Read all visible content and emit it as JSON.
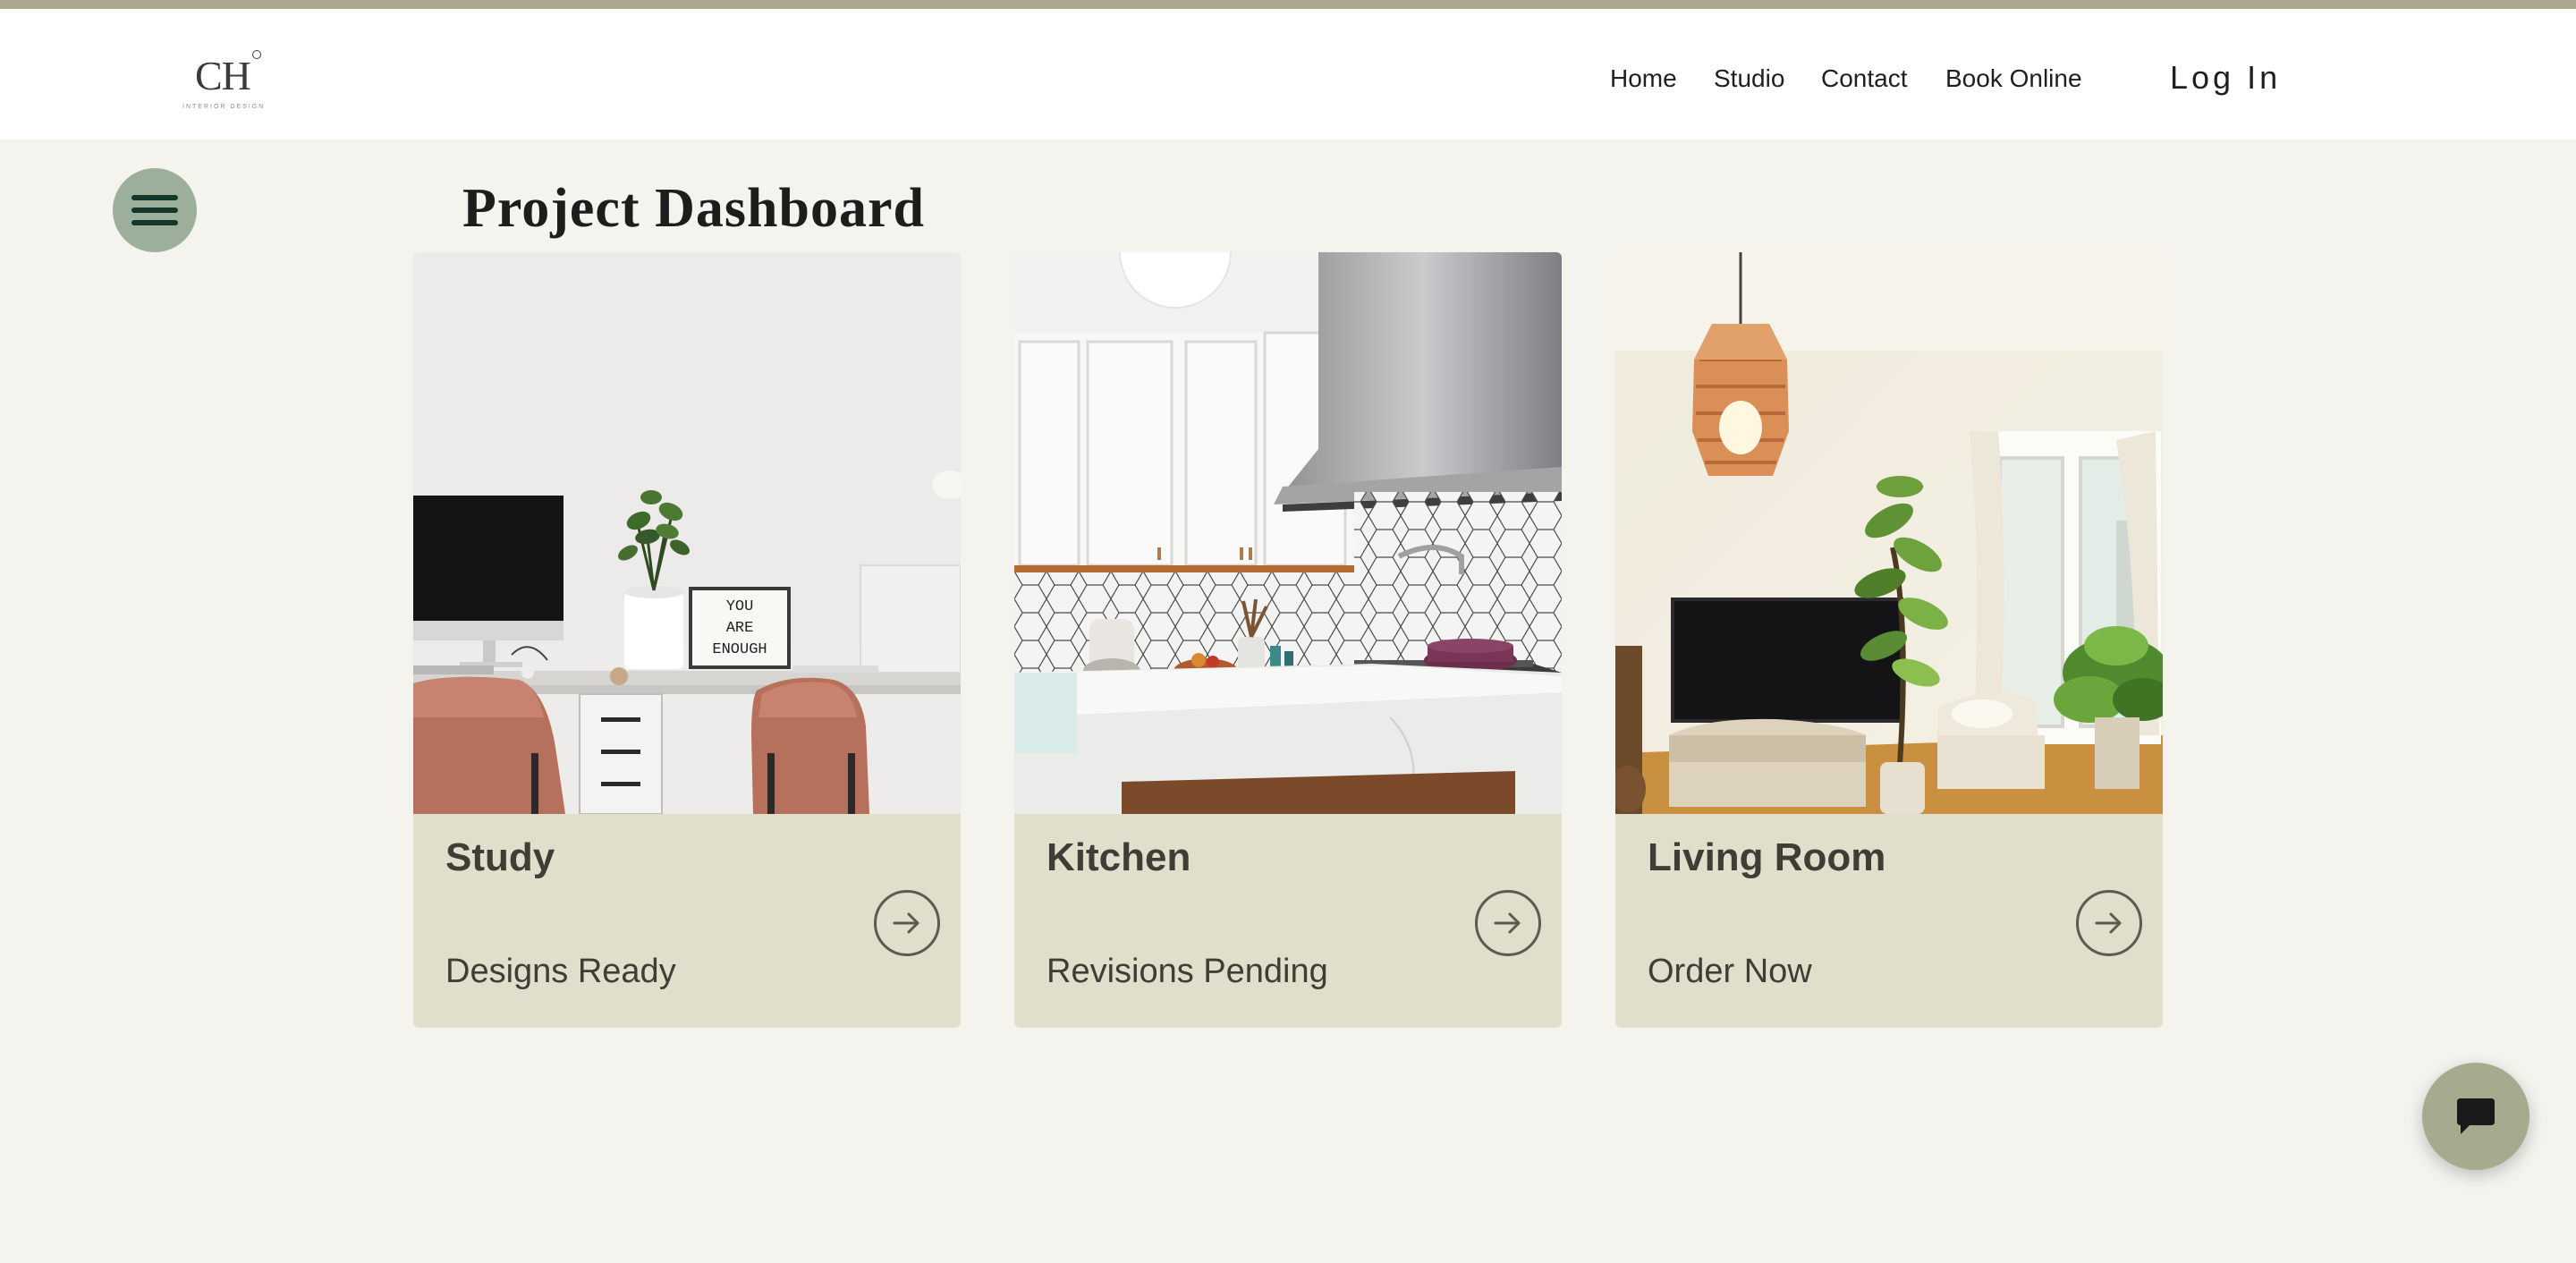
{
  "site": {
    "logo_text": "CH",
    "logo_subtitle": "INTERIOR DESIGN"
  },
  "nav": {
    "items": [
      "Home",
      "Studio",
      "Contact",
      "Book Online"
    ],
    "login_label": "Log In"
  },
  "page": {
    "title": "Project Dashboard"
  },
  "projects": [
    {
      "title": "Study",
      "status": "Designs Ready",
      "image": "home office desk with monitor, plant, lightbox sign and leather chairs",
      "sign_text": "YOU ARE ENOUGH"
    },
    {
      "title": "Kitchen",
      "status": "Revisions Pending",
      "image": "white kitchen with range hood, hexagon tile backsplash and marble counter"
    },
    {
      "title": "Living Room",
      "status": "Order Now",
      "image": "living room with rattan pendant lamp, television, plants and armchair"
    }
  ],
  "icons": {
    "menu": "hamburger-menu-icon",
    "card_link": "arrow-right-circle-icon",
    "chat": "chat-bubble-icon"
  },
  "colors": {
    "top_stripe": "#aaa88f",
    "page_background": "#f4f3ee",
    "card_background": "#e0dfcc",
    "menu_button": "#9caf9a",
    "chat_button": "#a8aa90"
  }
}
